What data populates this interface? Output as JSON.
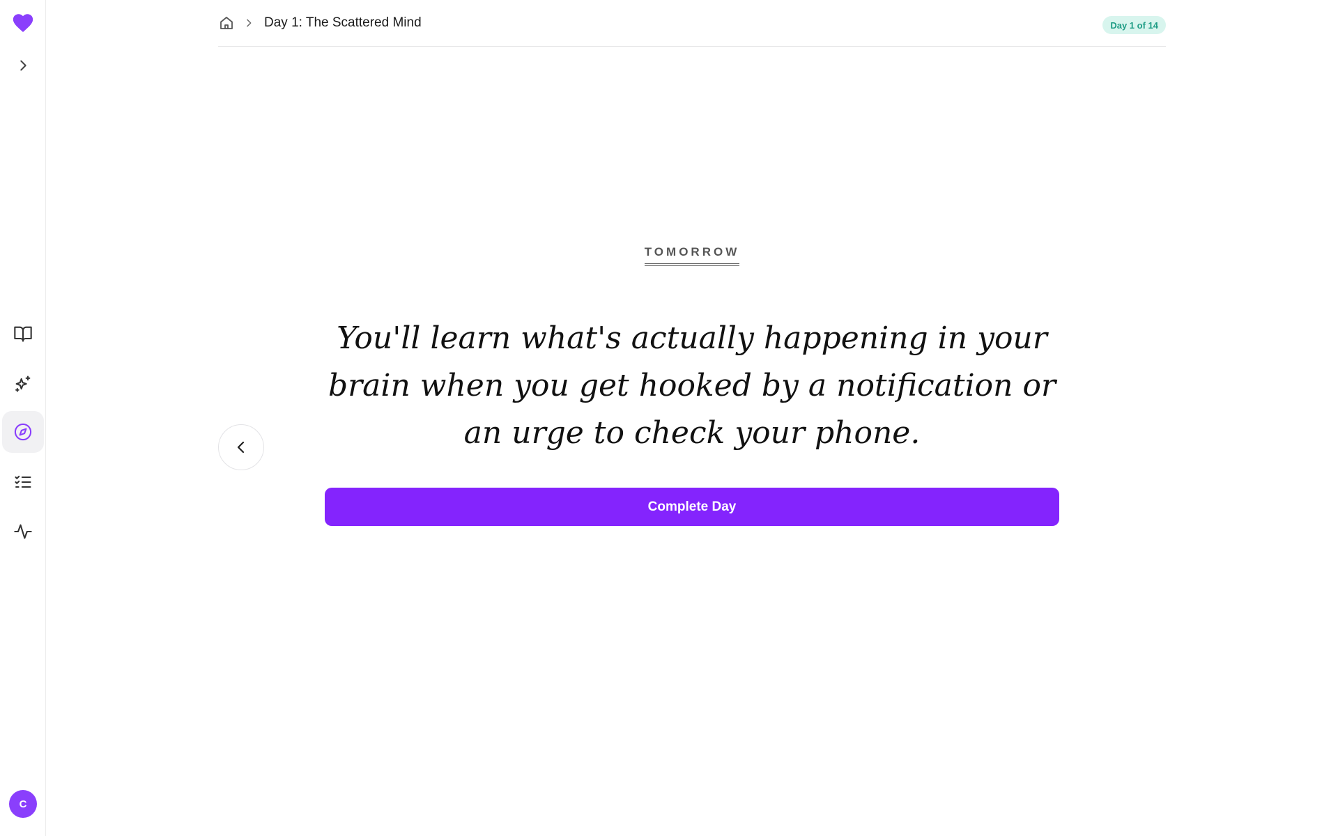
{
  "colors": {
    "accent": "#8424fd",
    "logo": "#8a3ffc",
    "badge_bg": "#d8f5ee",
    "badge_text": "#1f9d86"
  },
  "sidebar": {
    "logo_icon": "heart-icon",
    "expand_icon": "chevron-right-icon",
    "items": [
      {
        "id": "library",
        "icon": "book-open-icon",
        "active": false
      },
      {
        "id": "sparkles",
        "icon": "sparkles-icon",
        "active": false
      },
      {
        "id": "explore",
        "icon": "compass-icon",
        "active": true
      },
      {
        "id": "tasks",
        "icon": "checklist-icon",
        "active": false
      },
      {
        "id": "activity",
        "icon": "activity-pulse-icon",
        "active": false
      }
    ],
    "avatar_initial": "C"
  },
  "breadcrumb": {
    "home_icon": "home-icon",
    "separator_icon": "chevron-right-icon",
    "title": "Day 1: The Scattered Mind"
  },
  "progress_badge": "Day 1 of 14",
  "content": {
    "eyebrow": "TOMORROW",
    "quote": "You'll learn what's actually happening in your brain when you get hooked by a notification or an urge to check your phone.",
    "back_icon": "chevron-left-icon",
    "cta_label": "Complete Day"
  }
}
